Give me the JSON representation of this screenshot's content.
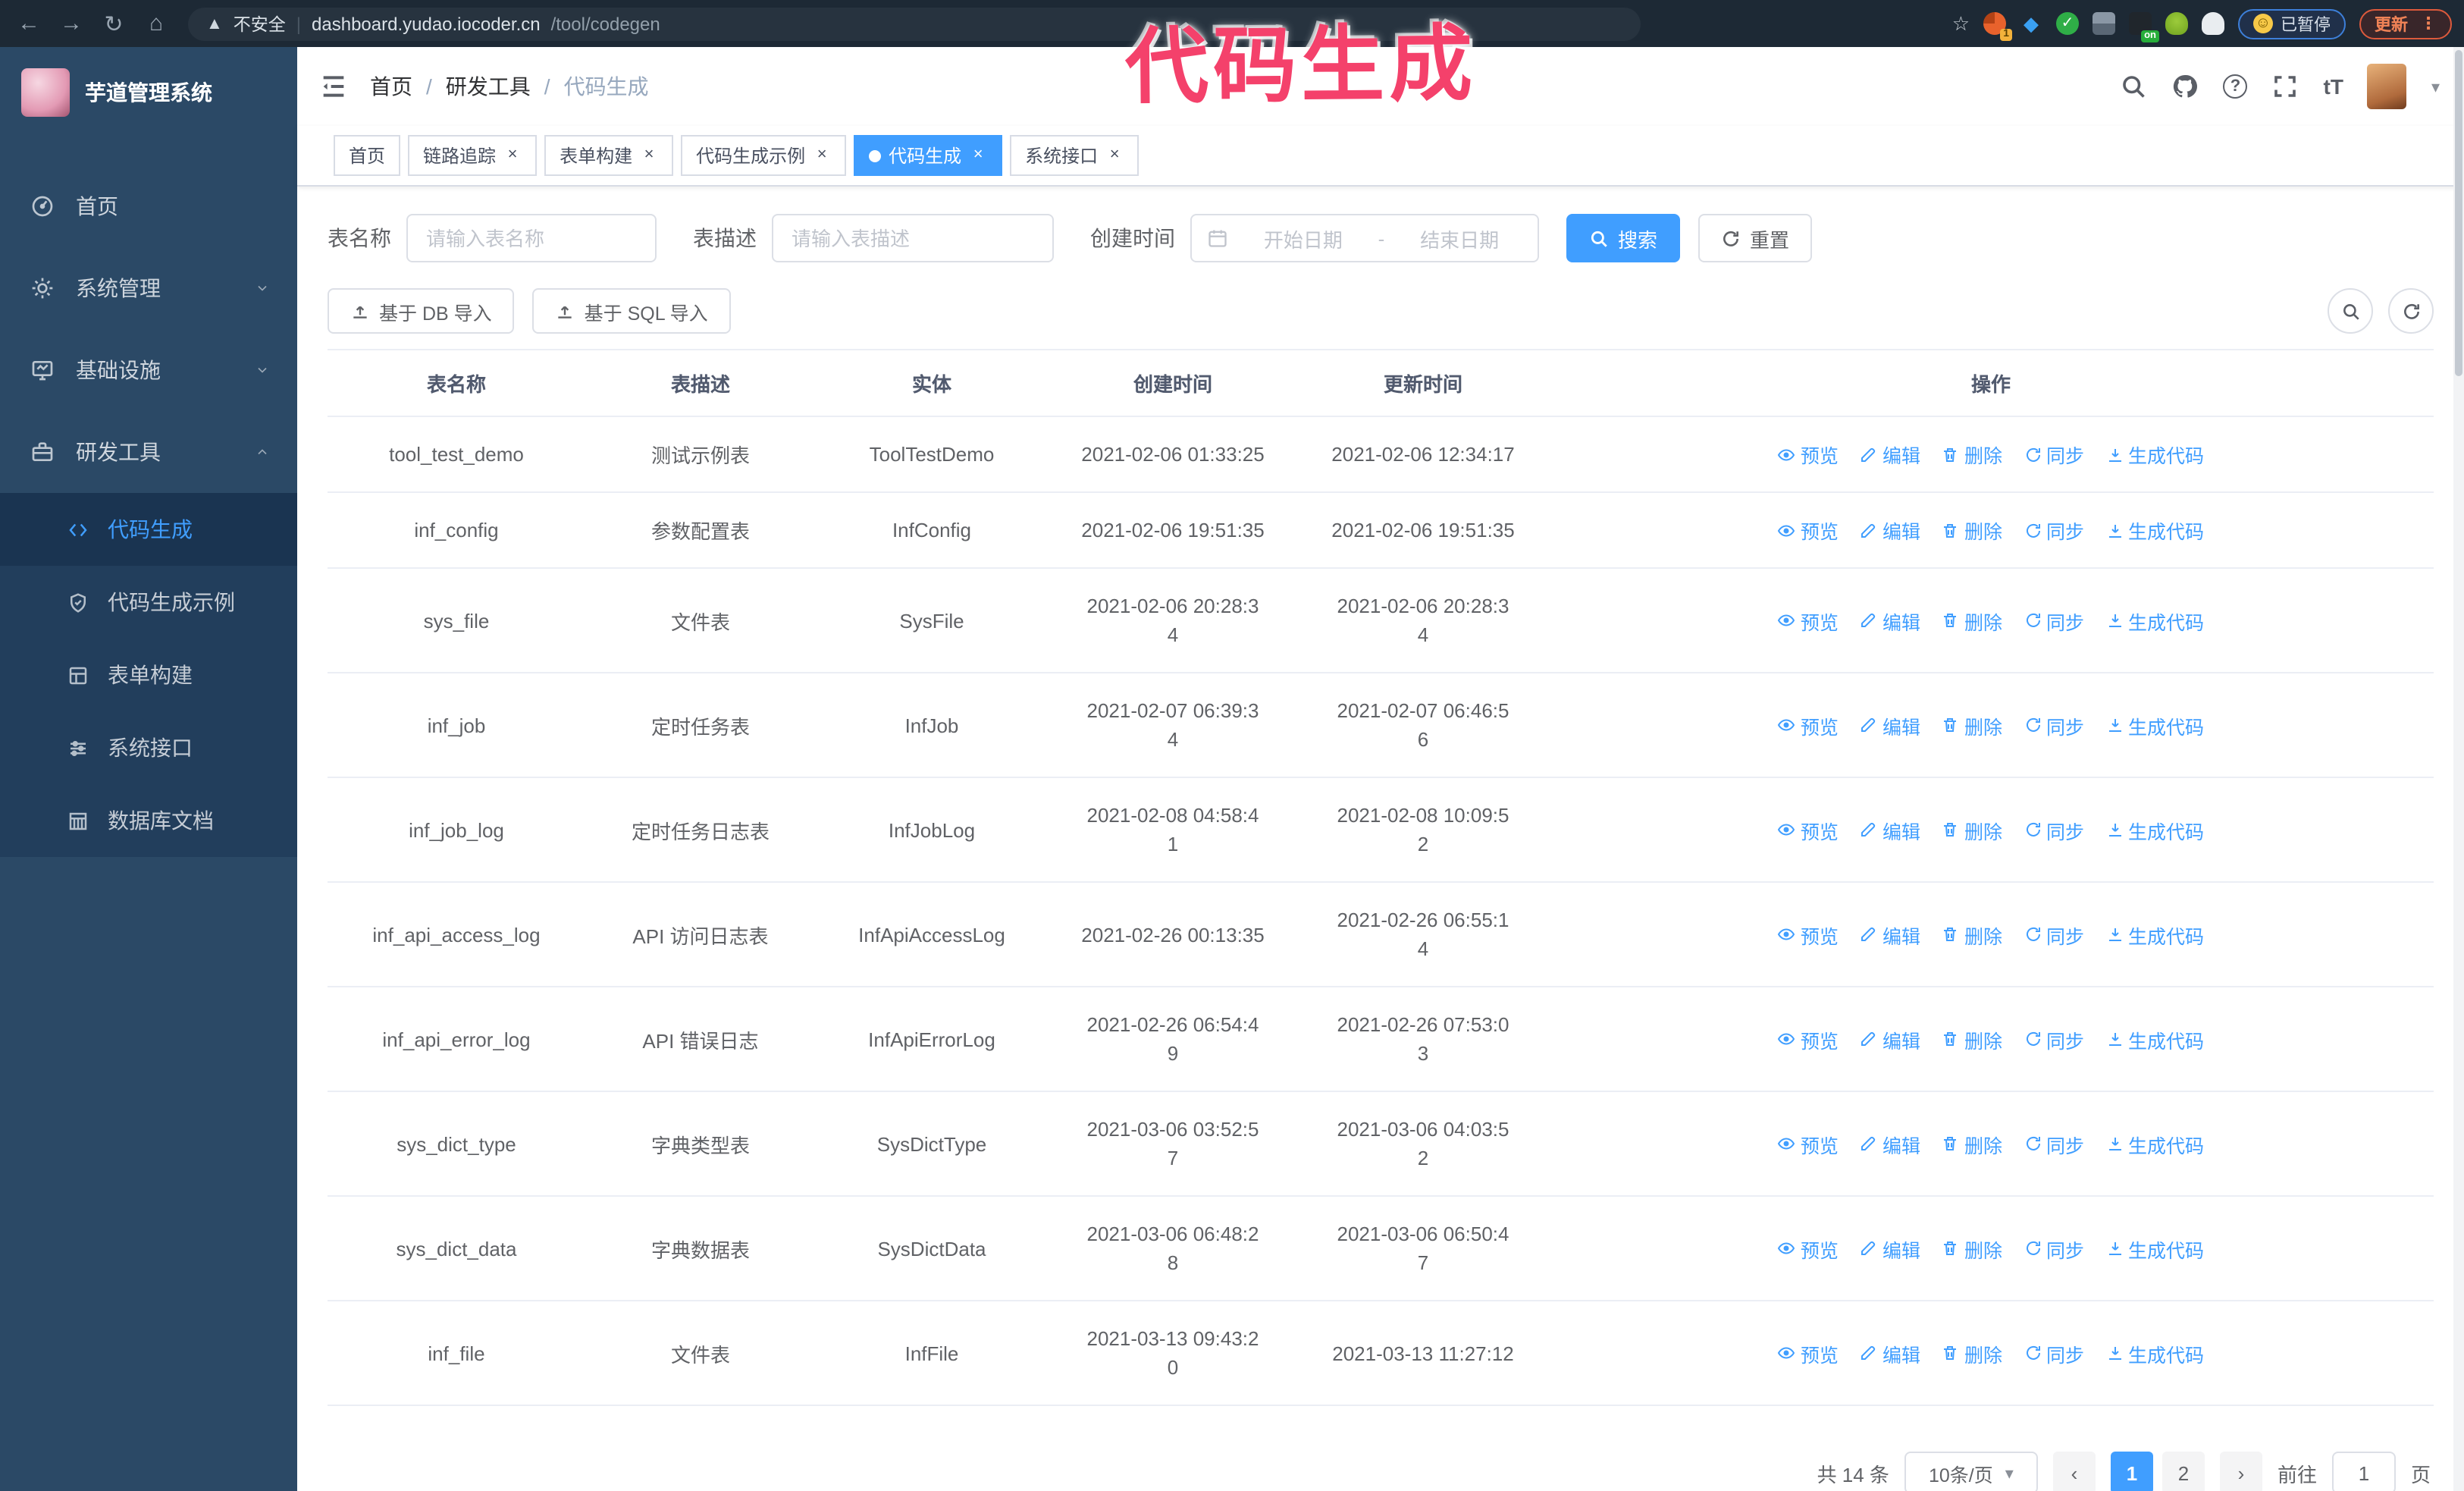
{
  "browser": {
    "security_warning": "不安全",
    "url_host": "dashboard.yudao.iocoder.cn",
    "url_path": "/tool/codegen",
    "paused_badge": "已暂停",
    "update_button": "更新"
  },
  "annotation_text": "代码生成",
  "sidebar": {
    "title": "芋道管理系统",
    "items": [
      {
        "label": "首页",
        "icon": "dashboard-icon",
        "chevron": ""
      },
      {
        "label": "系统管理",
        "icon": "gear-icon",
        "chevron": "down"
      },
      {
        "label": "基础设施",
        "icon": "monitor-icon",
        "chevron": "down"
      },
      {
        "label": "研发工具",
        "icon": "toolbox-icon",
        "chevron": "up"
      }
    ],
    "subitems": [
      {
        "label": "代码生成",
        "icon": "code-icon",
        "active": true
      },
      {
        "label": "代码生成示例",
        "icon": "shield-icon",
        "active": false
      },
      {
        "label": "表单构建",
        "icon": "form-icon",
        "active": false
      },
      {
        "label": "系统接口",
        "icon": "sliders-icon",
        "active": false
      },
      {
        "label": "数据库文档",
        "icon": "database-icon",
        "active": false
      }
    ]
  },
  "breadcrumb": [
    "首页",
    "研发工具",
    "代码生成"
  ],
  "tabs": [
    {
      "label": "首页",
      "closable": false,
      "active": false
    },
    {
      "label": "链路追踪",
      "closable": true,
      "active": false
    },
    {
      "label": "表单构建",
      "closable": true,
      "active": false
    },
    {
      "label": "代码生成示例",
      "closable": true,
      "active": false
    },
    {
      "label": "代码生成",
      "closable": true,
      "active": true
    },
    {
      "label": "系统接口",
      "closable": true,
      "active": false
    }
  ],
  "filters": {
    "table_name_label": "表名称",
    "table_name_placeholder": "请输入表名称",
    "table_desc_label": "表描述",
    "table_desc_placeholder": "请输入表描述",
    "create_time_label": "创建时间",
    "date_start_placeholder": "开始日期",
    "date_separator": "-",
    "date_end_placeholder": "结束日期",
    "search_button": "搜索",
    "reset_button": "重置"
  },
  "toolbar": {
    "db_import_button": "基于 DB 导入",
    "sql_import_button": "基于 SQL 导入"
  },
  "table": {
    "headers": [
      "表名称",
      "表描述",
      "实体",
      "创建时间",
      "更新时间",
      "操作"
    ],
    "action_labels": [
      "预览",
      "编辑",
      "删除",
      "同步",
      "生成代码"
    ],
    "rows": [
      {
        "name": "tool_test_demo",
        "desc": "测试示例表",
        "entity": "ToolTestDemo",
        "created": "2021-02-06 01:33:25",
        "updated": "2021-02-06 12:34:17"
      },
      {
        "name": "inf_config",
        "desc": "参数配置表",
        "entity": "InfConfig",
        "created": "2021-02-06 19:51:35",
        "updated": "2021-02-06 19:51:35"
      },
      {
        "name": "sys_file",
        "desc": "文件表",
        "entity": "SysFile",
        "created": [
          "2021-02-06 20:28:3",
          "4"
        ],
        "updated": [
          "2021-02-06 20:28:3",
          "4"
        ]
      },
      {
        "name": "inf_job",
        "desc": "定时任务表",
        "entity": "InfJob",
        "created": [
          "2021-02-07 06:39:3",
          "4"
        ],
        "updated": [
          "2021-02-07 06:46:5",
          "6"
        ]
      },
      {
        "name": "inf_job_log",
        "desc": "定时任务日志表",
        "entity": "InfJobLog",
        "created": [
          "2021-02-08 04:58:4",
          "1"
        ],
        "updated": [
          "2021-02-08 10:09:5",
          "2"
        ]
      },
      {
        "name": "inf_api_access_log",
        "desc": "API 访问日志表",
        "entity": "InfApiAccessLog",
        "created": "2021-02-26 00:13:35",
        "updated": [
          "2021-02-26 06:55:1",
          "4"
        ]
      },
      {
        "name": "inf_api_error_log",
        "desc": "API 错误日志",
        "entity": "InfApiErrorLog",
        "created": [
          "2021-02-26 06:54:4",
          "9"
        ],
        "updated": [
          "2021-02-26 07:53:0",
          "3"
        ]
      },
      {
        "name": "sys_dict_type",
        "desc": "字典类型表",
        "entity": "SysDictType",
        "created": [
          "2021-03-06 03:52:5",
          "7"
        ],
        "updated": [
          "2021-03-06 04:03:5",
          "2"
        ]
      },
      {
        "name": "sys_dict_data",
        "desc": "字典数据表",
        "entity": "SysDictData",
        "created": [
          "2021-03-06 06:48:2",
          "8"
        ],
        "updated": [
          "2021-03-06 06:50:4",
          "7"
        ]
      },
      {
        "name": "inf_file",
        "desc": "文件表",
        "entity": "InfFile",
        "created": [
          "2021-03-13 09:43:2",
          "0"
        ],
        "updated": "2021-03-13 11:27:12"
      }
    ]
  },
  "pagination": {
    "total": "共 14 条",
    "page_size": "10条/页",
    "pages": [
      "1",
      "2"
    ],
    "active_page": "1",
    "goto_label": "前往",
    "goto_value": "1",
    "goto_suffix": "页"
  },
  "colors": {
    "accent": "#409eff",
    "annotation": "#f4416b",
    "sidebar_bg": "#2b4966"
  }
}
